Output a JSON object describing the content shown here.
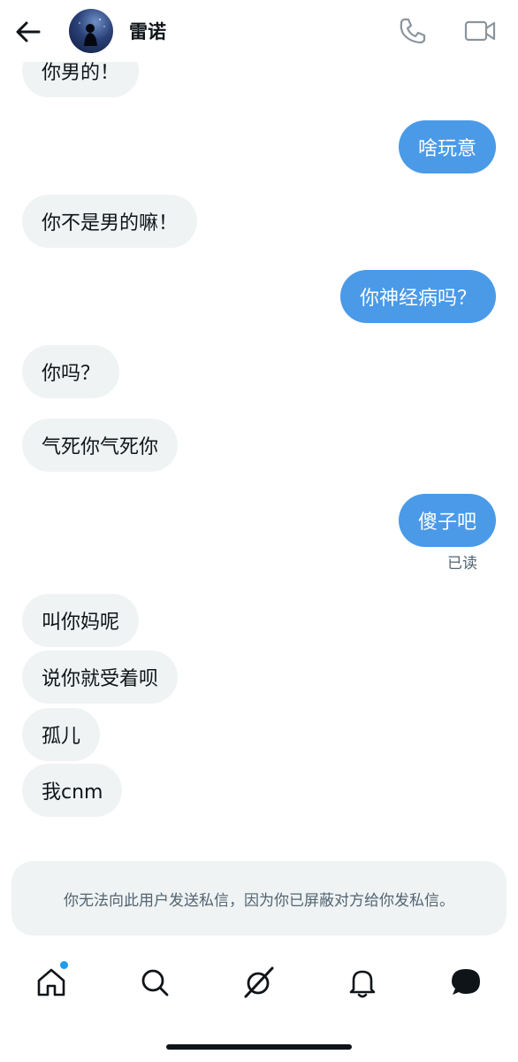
{
  "header": {
    "back_icon": "arrow-left-icon",
    "title": "雷诺",
    "call_icon": "phone-icon",
    "video_icon": "video-camera-icon"
  },
  "messages": [
    {
      "side": "in",
      "text": "你男的！"
    },
    {
      "side": "out",
      "text": "啥玩意"
    },
    {
      "side": "in",
      "text": "你不是男的嘛！"
    },
    {
      "side": "out",
      "text": "你神经病吗？"
    },
    {
      "side": "in",
      "text": "你吗？"
    },
    {
      "side": "in",
      "text": "气死你气死你"
    },
    {
      "side": "out",
      "text": "傻子吧"
    },
    {
      "side": "in",
      "text": "叫你妈呢"
    },
    {
      "side": "in",
      "text": "说你就受着呗"
    },
    {
      "side": "in",
      "text": "孤儿"
    },
    {
      "side": "in",
      "text": "我cnm"
    }
  ],
  "read_receipt": "已读",
  "blocked_notice": "你无法向此用户发送私信，因为你已屏蔽对方给你发私信。",
  "tabbar": {
    "items": [
      "home-icon",
      "search-icon",
      "grok-icon",
      "bell-icon",
      "messages-icon"
    ],
    "home_badge": true
  },
  "colors": {
    "accent": "#1d9bf0",
    "outgoing_bubble": "#4a9ae8",
    "incoming_bubble": "#eff3f4",
    "text_primary": "#0f1419",
    "text_secondary": "#536471"
  }
}
